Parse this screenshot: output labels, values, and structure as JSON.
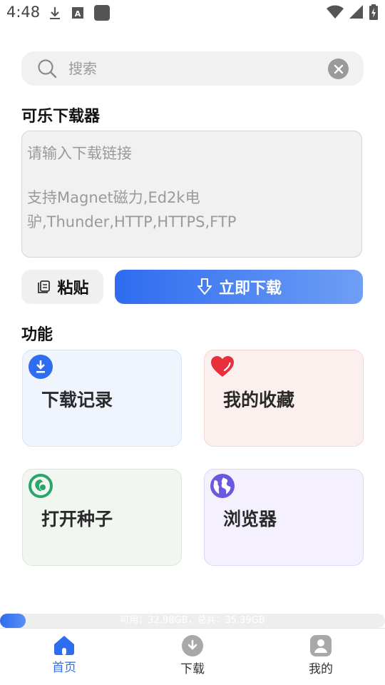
{
  "status_bar": {
    "time": "4:48",
    "icons_left": [
      "download-icon",
      "a-icon",
      "app-icon"
    ],
    "icons_right": [
      "wifi-icon",
      "signal-icon",
      "battery-icon"
    ]
  },
  "search": {
    "placeholder": "搜索",
    "value": ""
  },
  "downloader": {
    "title": "可乐下载器",
    "link_placeholder": "请输入下载链接",
    "support_text": "支持Magnet磁力,Ed2k电驴,Thunder,HTTP,HTTPS,FTP",
    "paste_label": "粘贴",
    "download_label": "立即下载"
  },
  "features": {
    "title": "功能",
    "cards": [
      {
        "label": "下载记录",
        "icon": "download-record-icon",
        "bg": "#eff4fd",
        "border": "#d7e3f7"
      },
      {
        "label": "我的收藏",
        "icon": "heart-icon",
        "bg": "#fcf0ee",
        "border": "#f5d6d0"
      },
      {
        "label": "打开种子",
        "icon": "torrent-icon",
        "bg": "#f2f6f1",
        "border": "#d8e8d8"
      },
      {
        "label": "浏览器",
        "icon": "globe-icon",
        "bg": "#f4f0fd",
        "border": "#e0d6f7"
      }
    ]
  },
  "storage": {
    "text": "可用：32.98GB，总共：35.39GB",
    "used_fraction": 0.07
  },
  "nav": {
    "items": [
      {
        "label": "首页",
        "icon": "home-icon",
        "active": true
      },
      {
        "label": "下载",
        "icon": "download-icon",
        "active": false
      },
      {
        "label": "我的",
        "icon": "user-icon",
        "active": false
      }
    ]
  },
  "colors": {
    "accent": "#2e6cf0",
    "nav_active": "#2e6cf0",
    "nav_inactive": "#a8a8a8"
  }
}
